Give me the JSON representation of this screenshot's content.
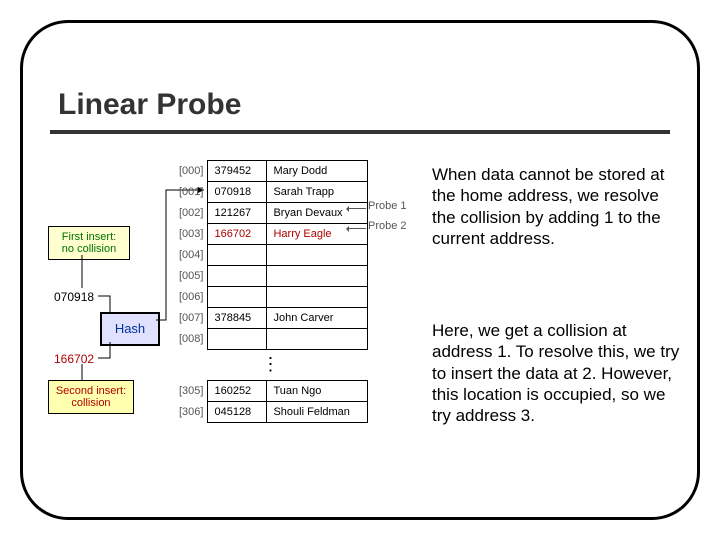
{
  "title": "Linear Probe",
  "paragraph1": "When data cannot be stored at the home address, we resolve the collision by adding 1 to the current address.",
  "paragraph2": "Here, we get a collision at address 1.  To resolve this, we try to insert the data at 2.  However, this location is occupied, so we try address 3.",
  "callouts": {
    "first": "First insert:\nno collision",
    "second": "Second insert:\ncollision"
  },
  "keys": {
    "k070918": "070918",
    "k166702": "166702"
  },
  "hash_label": "Hash",
  "probes": {
    "p1": "Probe 1",
    "p2": "Probe 2"
  },
  "rows": [
    {
      "idx": "[000]",
      "num": "379452",
      "name": "Mary Dodd",
      "collision": false
    },
    {
      "idx": "[001]",
      "num": "070918",
      "name": "Sarah Trapp",
      "collision": false
    },
    {
      "idx": "[002]",
      "num": "121267",
      "name": "Bryan Devaux",
      "collision": false
    },
    {
      "idx": "[003]",
      "num": "166702",
      "name": "Harry Eagle",
      "collision": true
    },
    {
      "idx": "[004]",
      "num": "",
      "name": "",
      "collision": false
    },
    {
      "idx": "[005]",
      "num": "",
      "name": "",
      "collision": false
    },
    {
      "idx": "[006]",
      "num": "",
      "name": "",
      "collision": false
    },
    {
      "idx": "[007]",
      "num": "378845",
      "name": "John Carver",
      "collision": false
    },
    {
      "idx": "[008]",
      "num": "",
      "name": "",
      "collision": false
    }
  ],
  "tail_rows": [
    {
      "idx": "[305]",
      "num": "160252",
      "name": "Tuan Ngo",
      "collision": false
    },
    {
      "idx": "[306]",
      "num": "045128",
      "name": "Shouli Feldman",
      "collision": false
    }
  ],
  "ellipsis": "⋮"
}
